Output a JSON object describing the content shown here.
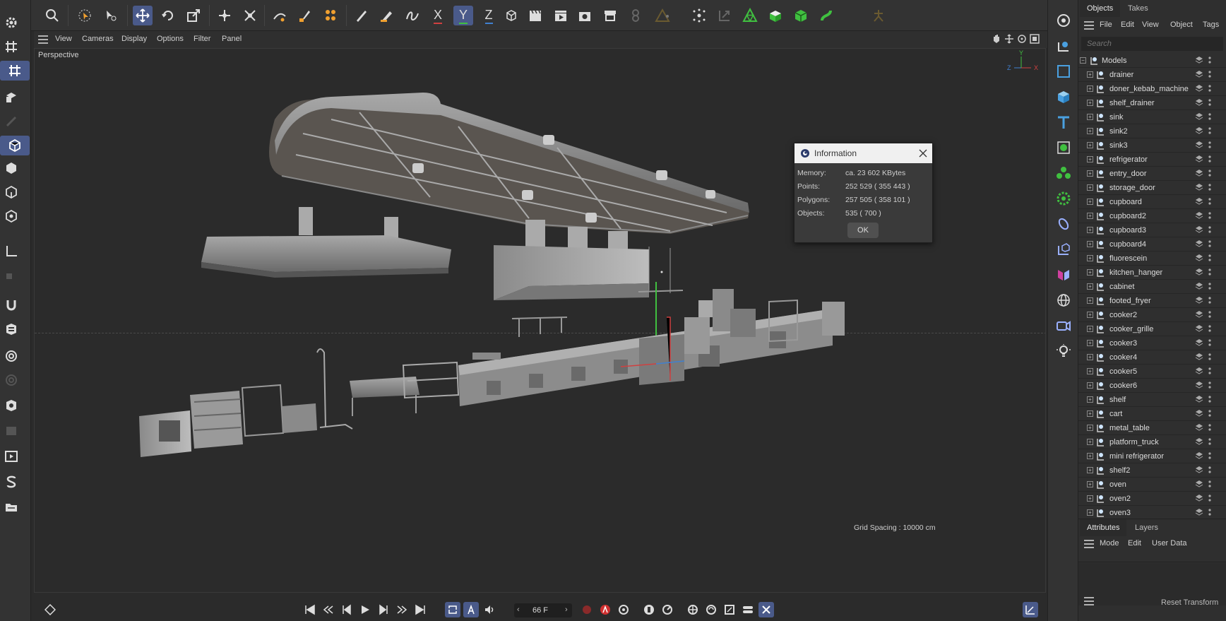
{
  "viewport_menu": [
    "View",
    "Cameras",
    "Display",
    "Options",
    "Filter",
    "Panel"
  ],
  "viewport_label": "Perspective",
  "grid_spacing": "Grid Spacing : 10000 cm",
  "axis": {
    "y": "Y",
    "z": "Z",
    "x": "X"
  },
  "top_toolbar_axis_labels": {
    "x": "X",
    "y": "Y",
    "z": "Z"
  },
  "timeline": {
    "frame": "66 F"
  },
  "objects_panel": {
    "tabs": [
      "Objects",
      "Takes"
    ],
    "menu": [
      "File",
      "Edit",
      "View",
      "Object",
      "Tags"
    ],
    "search_placeholder": "Search",
    "root": "Models",
    "items": [
      "drainer",
      "doner_kebab_machine",
      "shelf_drainer",
      "sink",
      "sink2",
      "sink3",
      "refrigerator",
      "entry_door",
      "storage_door",
      "cupboard",
      "cupboard2",
      "cupboard3",
      "cupboard4",
      "fluorescein",
      "kitchen_hanger",
      "cabinet",
      "footed_fryer",
      "cooker2",
      "cooker_grille",
      "cooker3",
      "cooker4",
      "cooker5",
      "cooker6",
      "shelf",
      "cart",
      "metal_table",
      "platform_truck",
      "mini refrigerator",
      "shelf2",
      "oven",
      "oven2",
      "oven3"
    ]
  },
  "attributes_panel": {
    "tabs": [
      "Attributes",
      "Layers"
    ],
    "menu": [
      "Mode",
      "Edit",
      "User Data"
    ],
    "reset_transform": "Reset Transform"
  },
  "info_dialog": {
    "title": "Information",
    "rows": [
      {
        "label": "Memory:",
        "value": "ca. 23 602 KBytes"
      },
      {
        "label": "Points:",
        "value": "252 529 ( 355 443 )"
      },
      {
        "label": "Polygons:",
        "value": "257 505 ( 358 101 )"
      },
      {
        "label": "Objects:",
        "value": "535 ( 700 )"
      }
    ],
    "ok": "OK"
  },
  "colors": {
    "accent": "#4a5a8a",
    "x_axis": "#d04040",
    "y_axis": "#40c040",
    "z_axis": "#4080d0"
  }
}
